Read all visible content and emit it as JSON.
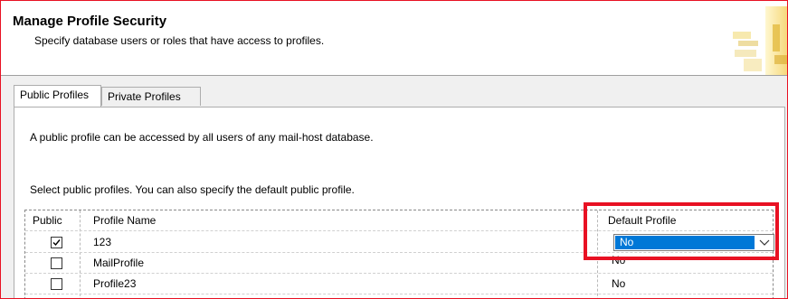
{
  "header": {
    "title": "Manage Profile Security",
    "subtitle": "Specify database users or roles that have access to profiles.",
    "graphic_icon": "database-key-icon"
  },
  "tabs": [
    {
      "label": "Public Profiles",
      "active": true
    },
    {
      "label": "Private Profiles",
      "active": false
    }
  ],
  "panel": {
    "description": "A public profile can be accessed by all users of any mail-host database.",
    "instruction": "Select public profiles. You can also specify the default public profile."
  },
  "grid": {
    "columns": [
      "Public",
      "Profile Name",
      "Default Profile"
    ],
    "rows": [
      {
        "public": true,
        "profile_name": "123",
        "default_profile": "No",
        "editing": true
      },
      {
        "public": false,
        "profile_name": "MailProfile",
        "default_profile": "No",
        "editing": false
      },
      {
        "public": false,
        "profile_name": "Profile23",
        "default_profile": "No",
        "editing": false
      }
    ]
  },
  "colors": {
    "annotation_border": "#e81123",
    "selection": "#0078d7"
  }
}
